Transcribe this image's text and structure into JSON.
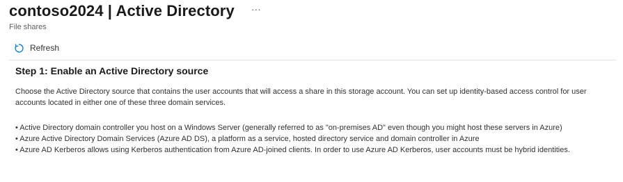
{
  "header": {
    "title": "contoso2024 | Active Directory",
    "more_label": "···",
    "subtitle": "File shares"
  },
  "toolbar": {
    "refresh_icon": "refresh-icon",
    "refresh_label": "Refresh"
  },
  "step": {
    "heading": "Step 1: Enable an Active Directory source",
    "description": "Choose the Active Directory source that contains the user accounts that will access a share in this storage account. You can set up identity-based access control for user accounts located in either one of these three domain services.",
    "bullets": [
      "• Active Directory domain controller you host on a Windows Server (generally referred to as \"on-premises AD\" even though you might host these servers in Azure)",
      "• Azure Active Directory Domain Services (Azure AD DS), a platform as a service, hosted directory service and domain controller in Azure",
      "• Azure AD Kerberos allows using Kerberos authentication from Azure AD-joined clients. In order to use Azure AD Kerberos, user accounts must be hybrid identities."
    ]
  },
  "colors": {
    "accent": "#0078d4",
    "text": "#323130",
    "muted": "#605e5c",
    "divider": "#e1dfdd"
  }
}
